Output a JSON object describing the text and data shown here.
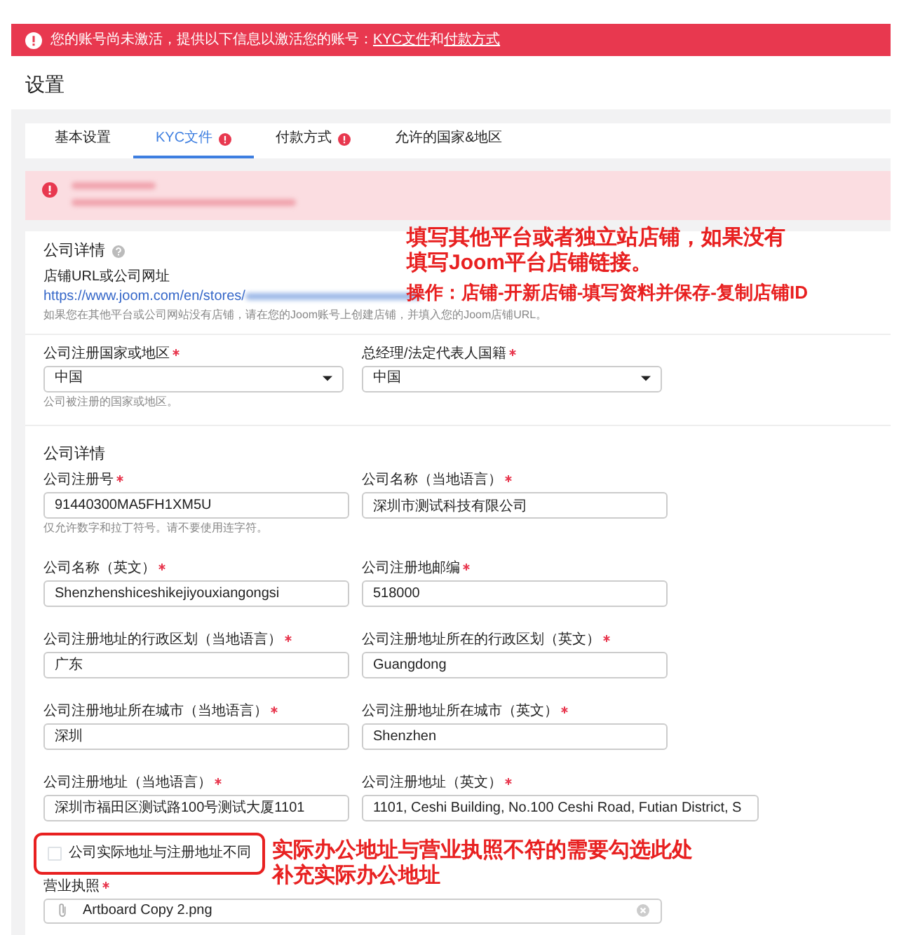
{
  "banner": {
    "segments": [
      {
        "kind": "text",
        "text": "您的账号尚未激活，提供以下信息以激活您的账号："
      },
      {
        "kind": "link",
        "text": "KYC文件"
      },
      {
        "kind": "text",
        "text": "和"
      },
      {
        "kind": "link",
        "text": "付款方式"
      }
    ]
  },
  "page_title": "设置",
  "tabs": [
    {
      "label": "基本设置",
      "alert": false,
      "selected": false
    },
    {
      "label": "KYC文件",
      "alert": true,
      "selected": true
    },
    {
      "label": "付款方式",
      "alert": true,
      "selected": false
    },
    {
      "label": "允许的国家&地区",
      "alert": false,
      "selected": false
    }
  ],
  "company_details": {
    "title": "公司详情",
    "store_url": {
      "label": "店铺URL或公司网址",
      "value": "https://www.joom.com/en/stores/",
      "hint": "如果您在其他平台或公司网站没有店铺，请在您的Joom账号上创建店铺，并填入您的Joom店铺URL。"
    }
  },
  "registration": {
    "fields": [
      {
        "kind": "select",
        "label": "公司注册国家或地区",
        "required": true,
        "value": "中国",
        "hint": "公司被注册的国家或地区。"
      },
      {
        "kind": "select",
        "label": "总经理/法定代表人国籍",
        "required": true,
        "value": "中国"
      }
    ]
  },
  "company_info": {
    "title": "公司详情",
    "fields": [
      {
        "kind": "text",
        "label": "公司注册号",
        "required": true,
        "value": "91440300MA5FH1XM5U",
        "hint": "仅允许数字和拉丁符号。请不要使用连字符。"
      },
      {
        "kind": "text",
        "label": "公司名称（当地语言）",
        "required": true,
        "value": "深圳市测试科技有限公司"
      },
      {
        "kind": "text",
        "label": "公司名称（英文）",
        "required": true,
        "value": "Shenzhenshiceshikejiyouxiangongsi"
      },
      {
        "kind": "text",
        "label": "公司注册地邮编",
        "required": true,
        "value": "518000"
      },
      {
        "kind": "text",
        "label": "公司注册地址的行政区划（当地语言）",
        "required": true,
        "value": "广东"
      },
      {
        "kind": "text",
        "label": "公司注册地址所在的行政区划（英文）",
        "required": true,
        "value": "Guangdong"
      },
      {
        "kind": "text",
        "label": "公司注册地址所在城市（当地语言）",
        "required": true,
        "value": "深圳"
      },
      {
        "kind": "text",
        "label": "公司注册地址所在城市（英文）",
        "required": true,
        "value": "Shenzhen"
      },
      {
        "kind": "text",
        "label": "公司注册地址（当地语言）",
        "required": true,
        "value": "深圳市福田区测试路100号测试大厦1101"
      },
      {
        "kind": "text",
        "label": "公司注册地址（英文）",
        "required": true,
        "value": "1101, Ceshi Building, No.100 Ceshi Road, Futian District, S"
      }
    ]
  },
  "address_checkbox": {
    "label": "公司实际地址与注册地址不同",
    "checked": false
  },
  "license": {
    "label": "营业执照",
    "required": true,
    "file": "Artboard Copy 2.png"
  },
  "annotations": [
    {
      "lines": [
        "填写其他平台或者独立站店铺，如果没有",
        "填写Joom平台店铺链接。"
      ],
      "sub": "操作：店铺-开新店铺-填写资料并保存-复制店铺ID"
    },
    {
      "lines": [
        "实际办公地址与营业执照不符的需要勾选此处",
        "补充实际办公地址"
      ]
    }
  ]
}
